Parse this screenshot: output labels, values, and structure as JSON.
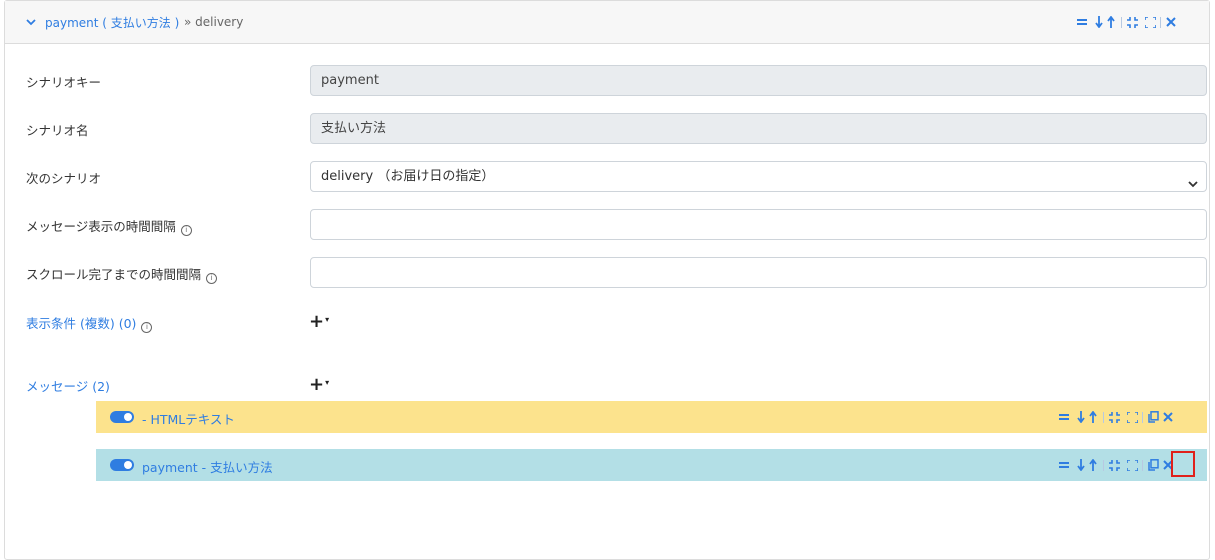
{
  "header": {
    "toggle_icon": "chevron-down-icon",
    "title": "payment ( 支払い方法 )",
    "next": "» delivery",
    "toolbar_icons": [
      "equals-icon",
      "arrow-down-icon",
      "arrow-up-icon",
      "collapse-icon",
      "expand-icon",
      "close-icon"
    ]
  },
  "form": {
    "scenario_key": {
      "label": "シナリオキー",
      "value": "payment"
    },
    "scenario_name": {
      "label": "シナリオ名",
      "value": "支払い方法"
    },
    "next_scenario": {
      "label": "次のシナリオ",
      "value": "delivery （お届け日の指定）"
    },
    "message_interval": {
      "label": "メッセージ表示の時間間隔",
      "value": ""
    },
    "scroll_interval": {
      "label": "スクロール完了までの時間間隔",
      "value": ""
    },
    "conditions": {
      "label": "表示条件 (複数) (0)"
    },
    "messages": {
      "label": "メッセージ (2)"
    },
    "info_glyph": "i",
    "plus_glyph": "+",
    "caret_glyph": "▾"
  },
  "messages": [
    {
      "label": "- HTMLテキスト",
      "color": "#fce38d",
      "enabled": true
    },
    {
      "label": "payment - 支払い方法",
      "color": "#b3dfe6",
      "enabled": true
    }
  ],
  "colors": {
    "accent": "#2f7de1",
    "highlight": "#e0201a"
  }
}
